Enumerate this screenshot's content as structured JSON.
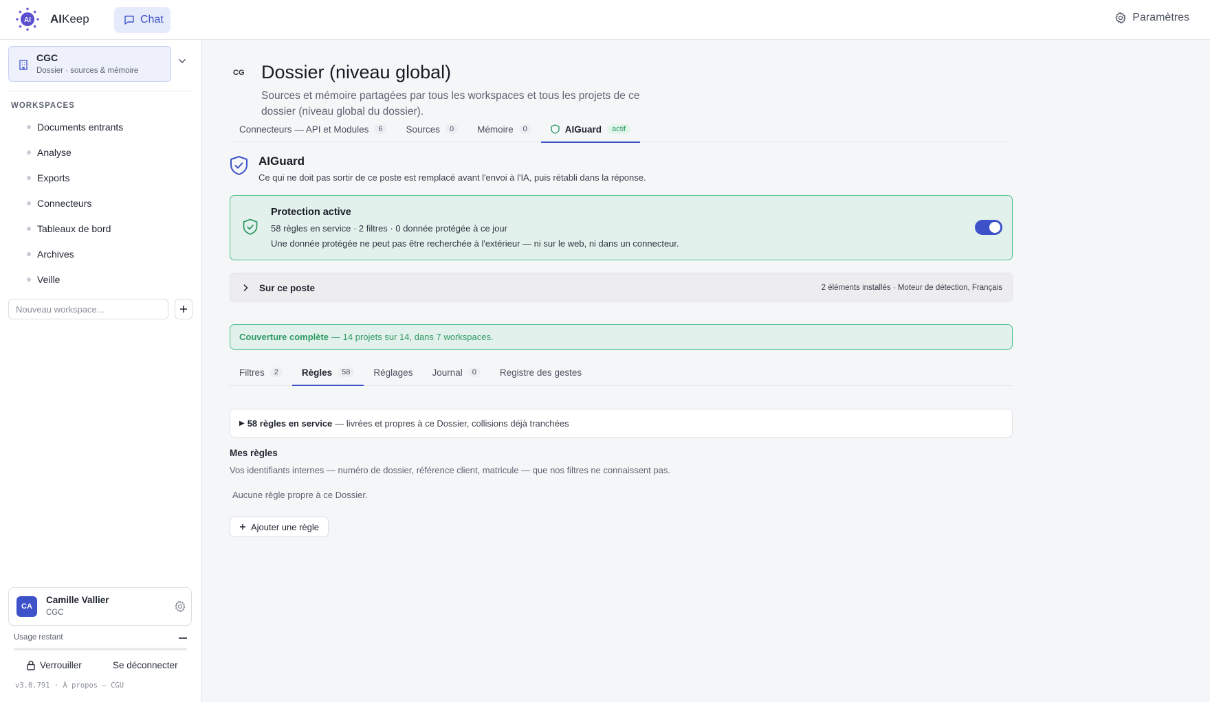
{
  "app": {
    "brand_strong": "AI",
    "brand_rest": "Keep",
    "logo_text": "AI",
    "logo_icon": "sparkle-ring-logo"
  },
  "header": {
    "chat_label": "Chat",
    "settings_label": "Paramètres"
  },
  "sidebar": {
    "folder": {
      "name": "CGC",
      "subtitle": "Dossier · sources & mémoire"
    },
    "workspaces_title": "WORKSPACES",
    "workspaces": [
      {
        "label": "Documents entrants"
      },
      {
        "label": "Analyse"
      },
      {
        "label": "Exports"
      },
      {
        "label": "Connecteurs"
      },
      {
        "label": "Tableaux de bord"
      },
      {
        "label": "Archives"
      },
      {
        "label": "Veille"
      }
    ],
    "new_workspace_placeholder": "Nouveau workspace...",
    "user": {
      "initials": "CA",
      "name": "Camille Vallier",
      "org": "CGC"
    },
    "usage_label": "Usage restant",
    "usage_fraction": 0.0,
    "lock_label": "Verrouiller",
    "logout_label": "Se déconnecter",
    "version": "v3.0.791 · À propos — CGU"
  },
  "main": {
    "badge": "CG",
    "title": "Dossier (niveau global)",
    "description": "Sources et mémoire partagées par tous les workspaces et tous les projets de ce dossier (niveau global du dossier).",
    "tabs": [
      {
        "label": "Connecteurs — API et Modules",
        "count": "6"
      },
      {
        "label": "Sources",
        "count": "0"
      },
      {
        "label": "Mémoire",
        "count": "0"
      },
      {
        "label": "AIGuard",
        "badge": "actif",
        "active": true
      }
    ],
    "aiguard": {
      "title": "AIGuard",
      "description": "Ce qui ne doit pas sortir de ce poste est remplacé avant l'envoi à l'IA, puis rétabli dans la réponse.",
      "protection": {
        "title": "Protection active",
        "line1": "58 règles en service · 2 filtres · 0 donnée protégée à ce jour",
        "line2": "Une donnée protégée ne peut pas être recherchée à l'extérieur — ni sur le web, ni dans un connecteur.",
        "enabled": true
      },
      "poste": {
        "title": "Sur ce poste",
        "meta": "2 éléments installés · Moteur de détection, Français"
      },
      "coverage": {
        "strong": "Couverture complète",
        "rest": "— 14 projets sur 14, dans 7 workspaces."
      },
      "subtabs": [
        {
          "label": "Filtres",
          "count": "2"
        },
        {
          "label": "Règles",
          "count": "58",
          "active": true
        },
        {
          "label": "Réglages"
        },
        {
          "label": "Journal",
          "count": "0"
        },
        {
          "label": "Registre des gestes"
        }
      ],
      "rules_summary": {
        "strong": "58 règles en service",
        "rest": "— livrées et propres à ce Dossier, collisions déjà tranchées"
      },
      "my_rules": {
        "title": "Mes règles",
        "description": "Vos identifiants internes — numéro de dossier, référence client, matricule — que nos filtres ne connaissent pas.",
        "empty": "Aucune règle propre à ce Dossier.",
        "add_label": "Ajouter une règle"
      }
    }
  },
  "colors": {
    "accent": "#3d52c9",
    "success": "#2f9a63",
    "success_bg": "#e3f1ec"
  }
}
